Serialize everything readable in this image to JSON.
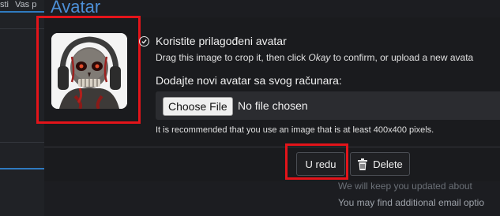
{
  "background": {
    "tabs": [
      "sti",
      "Vas p"
    ],
    "right_text_1": "We will keep you updated about",
    "right_text_2": "You may find additional email optio"
  },
  "dialog": {
    "title": "Avatar",
    "avatar_option_label": "Koristite prilagođeni avatar",
    "hint_prefix": "Drag this image to crop it, then click ",
    "hint_okay": "Okay",
    "hint_suffix": " to confirm, or upload a new avata",
    "upload_label": "Dodajte novi avatar sa svog računara:",
    "choose_file_label": "Choose File",
    "no_file_text": "No file chosen",
    "recommendation": "It is recommended that you use an image that is at least 400x400 pixels.",
    "ok_label": "U redu",
    "delete_label": "Delete"
  },
  "colors": {
    "accent_title": "#4d8fd6",
    "highlight": "#e3141a",
    "tab_underline": "#2f7ac0"
  },
  "icons": [
    "check-circle-icon",
    "trash-icon",
    "avatar-image"
  ]
}
